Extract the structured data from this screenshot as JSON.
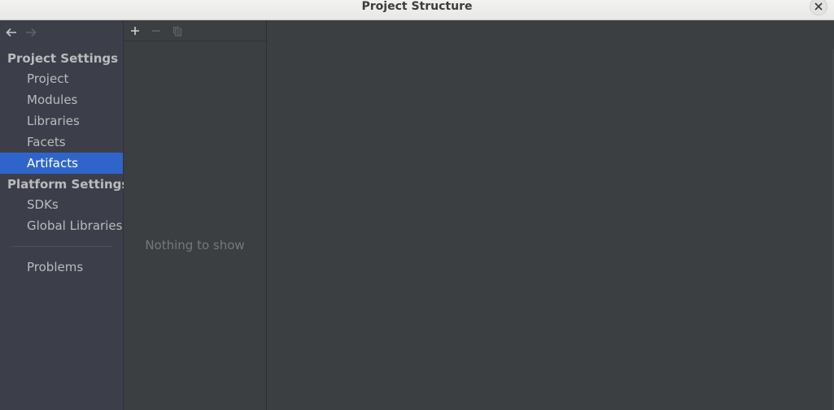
{
  "window": {
    "title": "Project Structure"
  },
  "toolbar": {
    "back_icon": "arrow-left-icon",
    "forward_icon": "arrow-right-icon",
    "add_icon": "plus-icon",
    "remove_icon": "minus-icon",
    "copy_icon": "copy-icon"
  },
  "sidebar": {
    "project_settings_header": "Project Settings",
    "project_items": [
      {
        "label": "Project"
      },
      {
        "label": "Modules"
      },
      {
        "label": "Libraries"
      },
      {
        "label": "Facets"
      },
      {
        "label": "Artifacts",
        "selected": true
      }
    ],
    "platform_settings_header": "Platform Settings",
    "platform_items": [
      {
        "label": "SDKs"
      },
      {
        "label": "Global Libraries"
      }
    ],
    "problems_label": "Problems"
  },
  "list": {
    "empty_text": "Nothing to show"
  },
  "colors": {
    "selection": "#2f65ca",
    "sidebar_bg": "#3c3f4a",
    "panel_bg": "#3c3f41",
    "text": "#bbbbbb",
    "muted_text": "#75787b"
  }
}
